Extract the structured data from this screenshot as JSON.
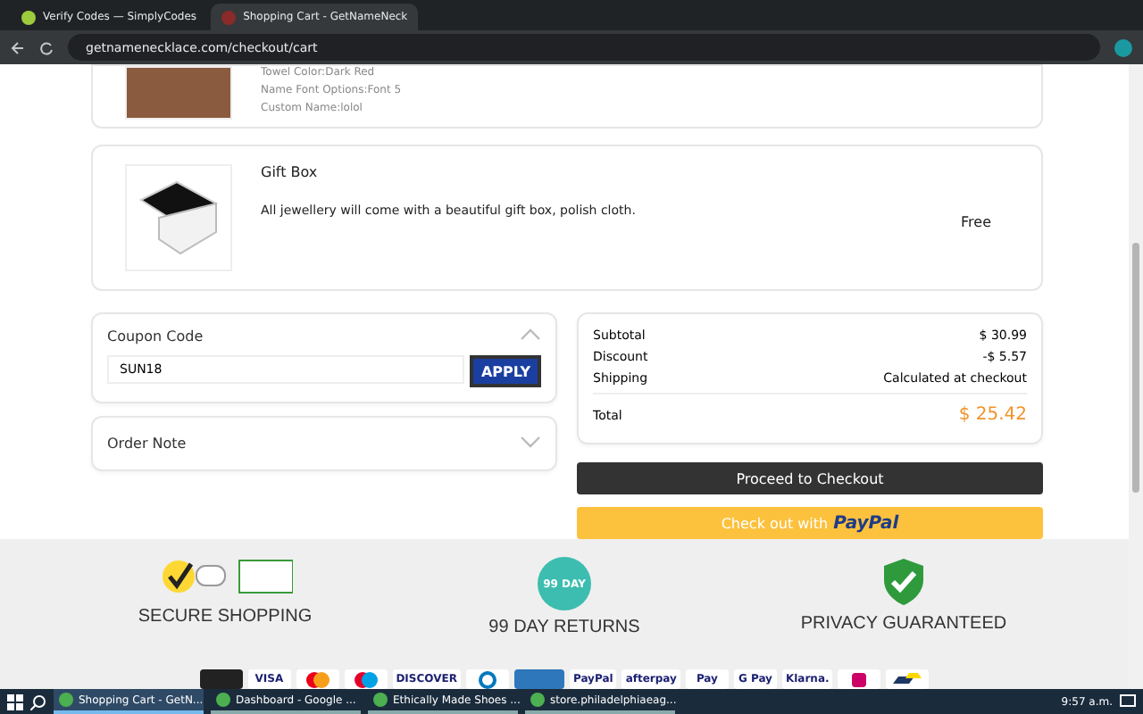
{
  "browser": {
    "tabs": [
      {
        "title": "Verify Codes — SimplyCodes",
        "selected": false
      },
      {
        "title": "Shopping Cart - GetNameNeck",
        "selected": true
      }
    ],
    "url": "getnamenecklace.com/checkout/cart"
  },
  "cart_items": [
    {
      "kind": "towel",
      "options": [
        "Towel Color:Dark Red",
        "Name Font Options:Font 5",
        "Custom Name:lolol"
      ]
    },
    {
      "kind": "giftbox",
      "title": "Gift Box",
      "options": [
        "All jewellery will come with a beautiful gift box, polish cloth."
      ],
      "price": "Free"
    }
  ],
  "coupon": {
    "label": "Coupon Code",
    "expanded": true,
    "value": "SUN18",
    "button": "APPLY"
  },
  "order_note": {
    "label": "Order Note",
    "expanded": false
  },
  "summary": {
    "rows": [
      {
        "label": "Subtotal",
        "value": "$ 30.99"
      },
      {
        "label": "Discount",
        "value": "-$ 5.57"
      },
      {
        "label": "Shipping",
        "value": "Calculated at checkout"
      }
    ],
    "total_label": "Total",
    "total": "$ 25.42"
  },
  "checkout_button": "Proceed to Checkout",
  "paypal_button": {
    "text": "Check out with",
    "brand": "PayPal"
  },
  "features": [
    {
      "kind": "security",
      "label": "SECURE SHOPPING"
    },
    {
      "kind": "returns",
      "badge": "99 DAY",
      "label": "99 DAY RETURNS"
    },
    {
      "kind": "shield",
      "label": "PRIVACY GUARANTEED"
    }
  ],
  "payment_methods": [
    {
      "kind": "block"
    },
    {
      "kind": "text",
      "label": "VISA"
    },
    {
      "kind": "mastercard"
    },
    {
      "kind": "maestro"
    },
    {
      "kind": "text",
      "label": "DISCOVER"
    },
    {
      "kind": "diners"
    },
    {
      "kind": "amex"
    },
    {
      "kind": "text",
      "label": "PayPal"
    },
    {
      "kind": "text",
      "label": "afterpay"
    },
    {
      "kind": "text",
      "label": "Pay"
    },
    {
      "kind": "text",
      "label": "G Pay"
    },
    {
      "kind": "text",
      "label": "Klarna."
    },
    {
      "kind": "ideal"
    },
    {
      "kind": "bancontact"
    }
  ],
  "taskbar": {
    "items": [
      {
        "title": "Shopping Cart - GetN...",
        "selected": true
      },
      {
        "title": "Dashboard - Google ...",
        "selected": false
      },
      {
        "title": "Ethically Made Shoes ...",
        "selected": false
      },
      {
        "title": "store.philadelphiaeag...",
        "selected": false
      }
    ],
    "time": "9:57 a.m."
  }
}
